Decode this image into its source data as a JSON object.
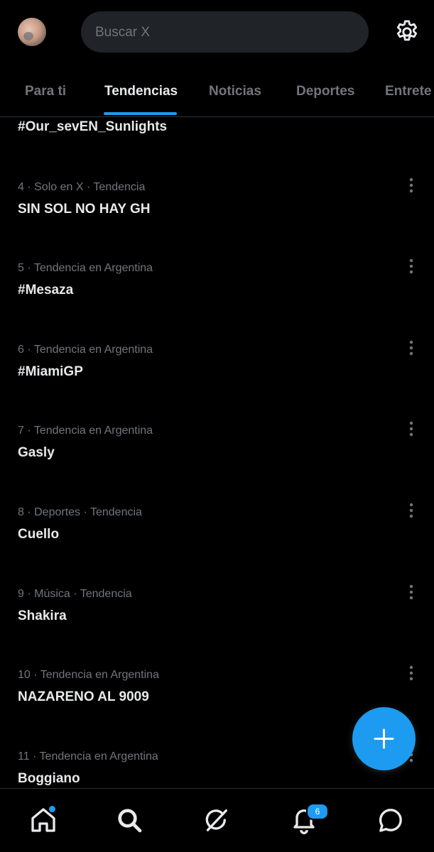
{
  "search": {
    "placeholder": "Buscar X"
  },
  "tabs": [
    {
      "label": "Para ti"
    },
    {
      "label": "Tendencias",
      "active": true
    },
    {
      "label": "Noticias"
    },
    {
      "label": "Deportes"
    },
    {
      "label": "Entrete"
    }
  ],
  "partial_trend": {
    "title": "#Our_sevEN_Sunlights"
  },
  "trends": [
    {
      "meta": "4 · Solo en X · Tendencia",
      "title": "SIN SOL NO HAY GH"
    },
    {
      "meta": "5 · Tendencia en Argentina",
      "title": "#Mesaza"
    },
    {
      "meta": "6 · Tendencia en Argentina",
      "title": "#MiamiGP"
    },
    {
      "meta": "7 · Tendencia en Argentina",
      "title": "Gasly"
    },
    {
      "meta": "8 · Deportes · Tendencia",
      "title": "Cuello"
    },
    {
      "meta": "9 · Música · Tendencia",
      "title": "Shakira"
    },
    {
      "meta": "10 · Tendencia en Argentina",
      "title": "NAZARENO AL 9009"
    },
    {
      "meta": "11 · Tendencia en Argentina",
      "title": "Boggiano"
    }
  ],
  "bottom_nav": {
    "items": [
      {
        "icon": "home-icon",
        "has_dot": true
      },
      {
        "icon": "search-icon",
        "active": true
      },
      {
        "icon": "grok-icon"
      },
      {
        "icon": "bell-icon",
        "badge": "6"
      },
      {
        "icon": "messages-icon"
      }
    ]
  },
  "colors": {
    "accent": "#1d9bf0",
    "background": "#000000",
    "text": "#e7e9ea",
    "secondary_text": "#71767b"
  }
}
